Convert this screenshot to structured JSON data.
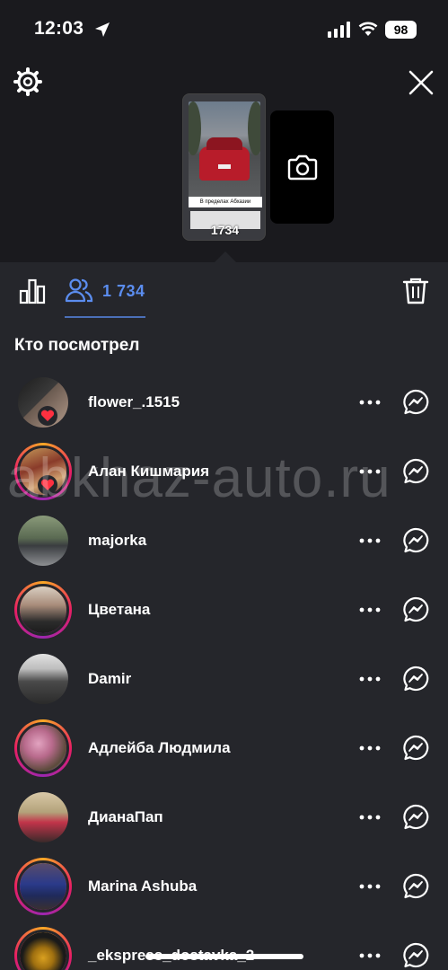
{
  "status_bar": {
    "time": "12:03",
    "battery": "98"
  },
  "story": {
    "caption": "В пределах Абхазии",
    "viewers_overlay": "1734"
  },
  "tabs": {
    "viewers_count": "1 734"
  },
  "section_title": "Кто посмотрел",
  "viewers": [
    {
      "username": "flower_.1515",
      "liked": true,
      "ring": false
    },
    {
      "username": "Алан Кишмария",
      "liked": true,
      "ring": true
    },
    {
      "username": "majorka",
      "liked": false,
      "ring": false
    },
    {
      "username": "Цветана",
      "liked": false,
      "ring": true
    },
    {
      "username": "Damir",
      "liked": false,
      "ring": false
    },
    {
      "username": "Адлейба Людмила",
      "liked": false,
      "ring": true
    },
    {
      "username": "ДианаПап",
      "liked": false,
      "ring": false
    },
    {
      "username": "Marina Ashuba",
      "liked": false,
      "ring": true
    },
    {
      "username": "_ekspress_dostavka_2",
      "liked": false,
      "ring": true
    }
  ],
  "watermark": "abkhaz-auto.ru",
  "colors": {
    "accent": "#5b8def",
    "background": "#25262b",
    "top_background": "#1a1a1e",
    "heart": "#ff3040"
  },
  "icons": [
    "location-arrow-icon",
    "signal-icon",
    "wifi-icon",
    "gear-icon",
    "close-icon",
    "camera-icon",
    "bar-chart-icon",
    "people-icon",
    "trash-icon",
    "heart-icon",
    "more-icon",
    "messenger-icon"
  ]
}
